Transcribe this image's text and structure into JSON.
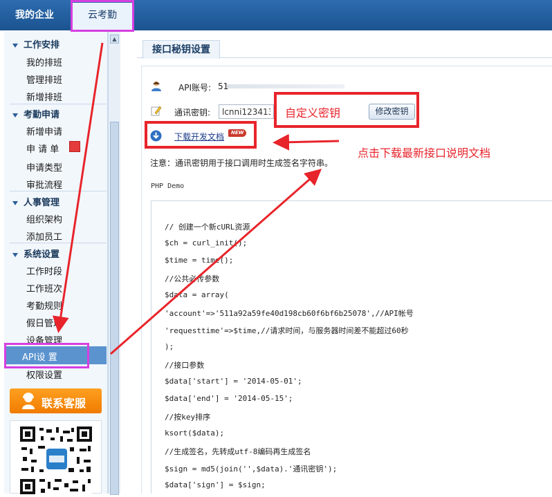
{
  "topbar": {
    "tab_company": "我的企业",
    "tab_attendance": "云考勤"
  },
  "sidebar": {
    "groups": [
      {
        "label": "工作安排",
        "items": [
          "我的排班",
          "管理排班",
          "新增排班"
        ]
      },
      {
        "label": "考勤申请",
        "items": [
          "新增申请",
          "申 请 单",
          "申请类型",
          "审批流程"
        ]
      },
      {
        "label": "人事管理",
        "items": [
          "组织架构",
          "添加员工"
        ]
      },
      {
        "label": "系统设置",
        "items": [
          "工作时段",
          "工作班次",
          "考勤规则",
          "假日管理",
          "设备管理",
          "API设 置",
          "权限设置"
        ]
      }
    ],
    "active_item": "API设 置",
    "service_button": "联系客服"
  },
  "main": {
    "title": "接口秘钥设置",
    "api_account_label": "API账号:",
    "api_account_value": "51",
    "secret_label": "通讯密钥:",
    "secret_value": "lcnni123413",
    "modify_button": "修改密钥",
    "custom_key_annotation": "自定义密钥",
    "download_link": "下载开发文档",
    "new_badge": "NEW",
    "download_annotation": "点击下载最新接口说明文档",
    "note": "注意：通讯密钥用于接口调用时生成签名字符串。",
    "demo_label": "PHP Demo",
    "code_lines": [
      "// 创建一个新cURL资源",
      "$ch = curl_init();",
      "$time = time();",
      "//公共必传参数",
      "$data = array(",
      "'account'=>'511a92a59fe40d198cb60f6bf6b25078',//API帐号",
      "'requesttime'=>$time,//请求时间，与服务器时间差不能超过60秒",
      ");",
      "//接口参数",
      "$data['start'] = '2014-05-01';",
      "$data['end'] = '2014-05-15';",
      "//按key排序",
      "ksort($data);",
      "//生成签名，先转成utf-8编码再生成签名",
      "$sign = md5(join('',$data).'通讯密钥');",
      "$data['sign'] = $sign;"
    ]
  },
  "colors": {
    "annotation_red": "#e8242b",
    "highlight_magenta": "#d63fe0",
    "topbar_blue": "#1b538f"
  }
}
